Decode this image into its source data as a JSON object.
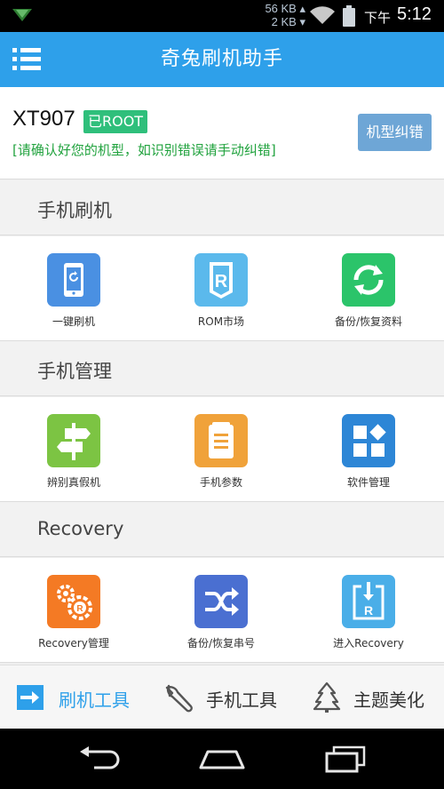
{
  "status_bar": {
    "net_up": "56 KB",
    "net_down": "2 KB",
    "ampm": "下午",
    "time": "5:12",
    "icons": [
      "notification-icon",
      "wifi-icon",
      "battery-icon"
    ]
  },
  "header": {
    "title": "奇兔刷机助手",
    "menu_icon": "menu-icon"
  },
  "device": {
    "model": "XT907",
    "root_status": "已ROOT",
    "confirm_text": "[请确认好您的机型，如识别错误请手动纠错]",
    "fix_button": "机型纠错"
  },
  "sections": [
    {
      "title": "手机刷机",
      "items": [
        {
          "label": "一键刷机",
          "icon": "phone-flash-icon",
          "color": "#4a90e2"
        },
        {
          "label": "ROM市场",
          "icon": "rom-market-icon",
          "color": "#5bb9ec"
        },
        {
          "label": "备份/恢复资料",
          "icon": "sync-icon",
          "color": "#2bc46a"
        }
      ]
    },
    {
      "title": "手机管理",
      "items": [
        {
          "label": "辨别真假机",
          "icon": "signpost-icon",
          "color": "#7cc443"
        },
        {
          "label": "手机参数",
          "icon": "document-icon",
          "color": "#f0a23a"
        },
        {
          "label": "软件管理",
          "icon": "apps-grid-icon",
          "color": "#2d86d6"
        }
      ]
    },
    {
      "title": "Recovery",
      "items": [
        {
          "label": "Recovery管理",
          "icon": "gears-icon",
          "color": "#f47a24"
        },
        {
          "label": "备份/恢复串号",
          "icon": "shuffle-icon",
          "color": "#4a6fd1"
        },
        {
          "label": "进入Recovery",
          "icon": "enter-recovery-icon",
          "color": "#4aaee8"
        }
      ]
    }
  ],
  "tabs": [
    {
      "label": "刷机工具",
      "icon": "flash-tool-icon",
      "active": true
    },
    {
      "label": "手机工具",
      "icon": "wrench-icon",
      "active": false
    },
    {
      "label": "主题美化",
      "icon": "tree-icon",
      "active": false
    }
  ],
  "colors": {
    "header": "#2ea0ea",
    "active_tab": "#2ea0ea",
    "root_badge": "#2fbf7b",
    "confirm_text": "#22a33f",
    "fix_button": "#6ea6d6"
  },
  "nav": [
    "back-icon",
    "home-icon",
    "recents-icon"
  ]
}
